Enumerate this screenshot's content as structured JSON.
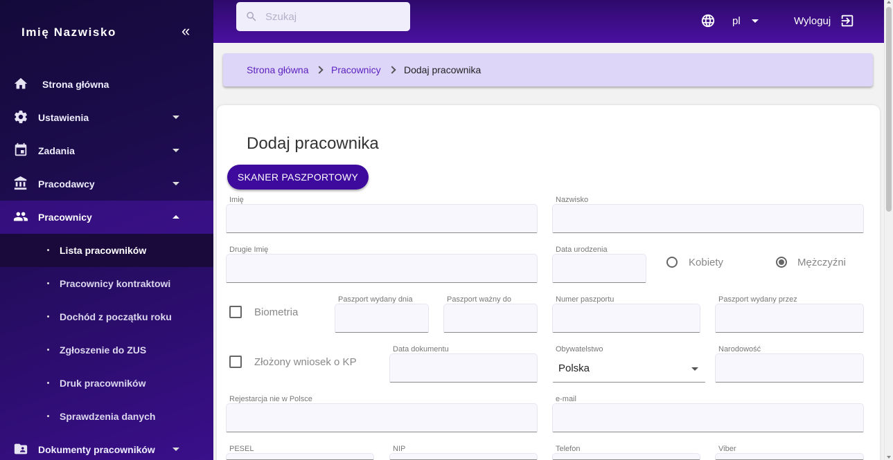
{
  "sidebar": {
    "user_name": "Imię Nazwisko",
    "collapse_glyph": "«",
    "items": [
      {
        "label": "Strona główna",
        "icon": "home-icon"
      },
      {
        "label": "Ustawienia",
        "icon": "gear-icon"
      },
      {
        "label": "Zadania",
        "icon": "calendar-icon"
      },
      {
        "label": "Pracodawcy",
        "icon": "bank-icon"
      },
      {
        "label": "Pracownicy",
        "icon": "people-icon"
      },
      {
        "label": "Dokumenty pracowników",
        "icon": "folder-account-icon"
      }
    ],
    "sub_items": [
      {
        "label": "Lista pracowników"
      },
      {
        "label": "Pracownicy kontraktowi"
      },
      {
        "label": "Dochód z początku roku"
      },
      {
        "label": "Zgłoszenie do ZUS"
      },
      {
        "label": "Druk pracowników"
      },
      {
        "label": "Sprawdzenia danych"
      }
    ]
  },
  "topbar": {
    "search_placeholder": "Szukaj",
    "language": "pl",
    "logout_label": "Wyloguj"
  },
  "breadcrumb": {
    "items": [
      "Strona główna",
      "Pracownicy"
    ],
    "current": "Dodaj pracownika"
  },
  "form": {
    "title": "Dodaj pracownika",
    "scan_button": "SKANER PASZPORTOWY",
    "labels": {
      "first_name": "Imię",
      "last_name": "Nazwisko",
      "middle_name": "Drugie Imię",
      "birth_date": "Data urodzenia",
      "passport_issued_date": "Paszport wydany dnia",
      "passport_valid_to": "Paszport ważny do",
      "passport_number": "Numer paszportu",
      "passport_issued_by": "Paszport wydany przez",
      "document_date": "Data dokumentu",
      "citizenship": "Obywatelstwo",
      "nationality": "Narodowość",
      "registration": "Rejestarcja nie w Polsce",
      "email": "e-mail",
      "pesel": "PESEL",
      "nip": "NIP",
      "phone": "Telefon",
      "viber": "Viber"
    },
    "gender_options": [
      "Kobiety",
      "Mężczyźni"
    ],
    "gender_selected": "Mężczyźni",
    "biometrics_label": "Biometria",
    "kp_label": "Złożony wniosek o KP",
    "citizenship_value": "Polska"
  },
  "colors": {
    "accent": "#3e0a9e",
    "sidebar_dark": "#140a3a",
    "breadcrumb_bg": "#ddd6f8",
    "link": "#5a1fbf"
  }
}
